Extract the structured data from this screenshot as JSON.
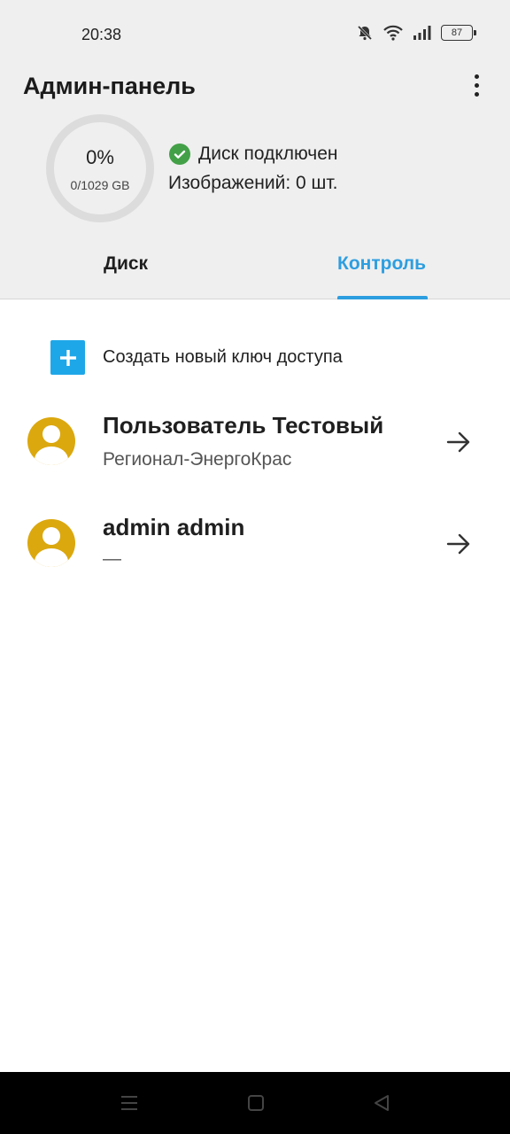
{
  "status_bar": {
    "time": "20:38",
    "battery": "87",
    "icons": [
      "bell-muted-icon",
      "wifi-icon",
      "signal-icon",
      "battery-icon"
    ]
  },
  "header": {
    "title": "Админ-панель",
    "menu_icon": "more-vert-icon"
  },
  "disk": {
    "usage_percent": "0%",
    "usage_fraction": 0,
    "capacity": "0/1029 GB",
    "status": "Диск подключен",
    "images": "Изображений: 0 шт."
  },
  "tabs": [
    {
      "label": "Диск",
      "active": false
    },
    {
      "label": "Контроль",
      "active": true
    }
  ],
  "actions": {
    "create_key": "Создать новый ключ доступа"
  },
  "users": [
    {
      "name": "Пользователь Тестовый",
      "org": "Регионал-ЭнергоКрас"
    },
    {
      "name": "admin admin",
      "org": "—"
    }
  ],
  "colors": {
    "accent": "#2d9ee0",
    "plus_button": "#1ea7e8",
    "avatar": "#dba80e",
    "check": "#43a047"
  },
  "nav": [
    "menu-icon",
    "home-icon",
    "back-icon"
  ]
}
